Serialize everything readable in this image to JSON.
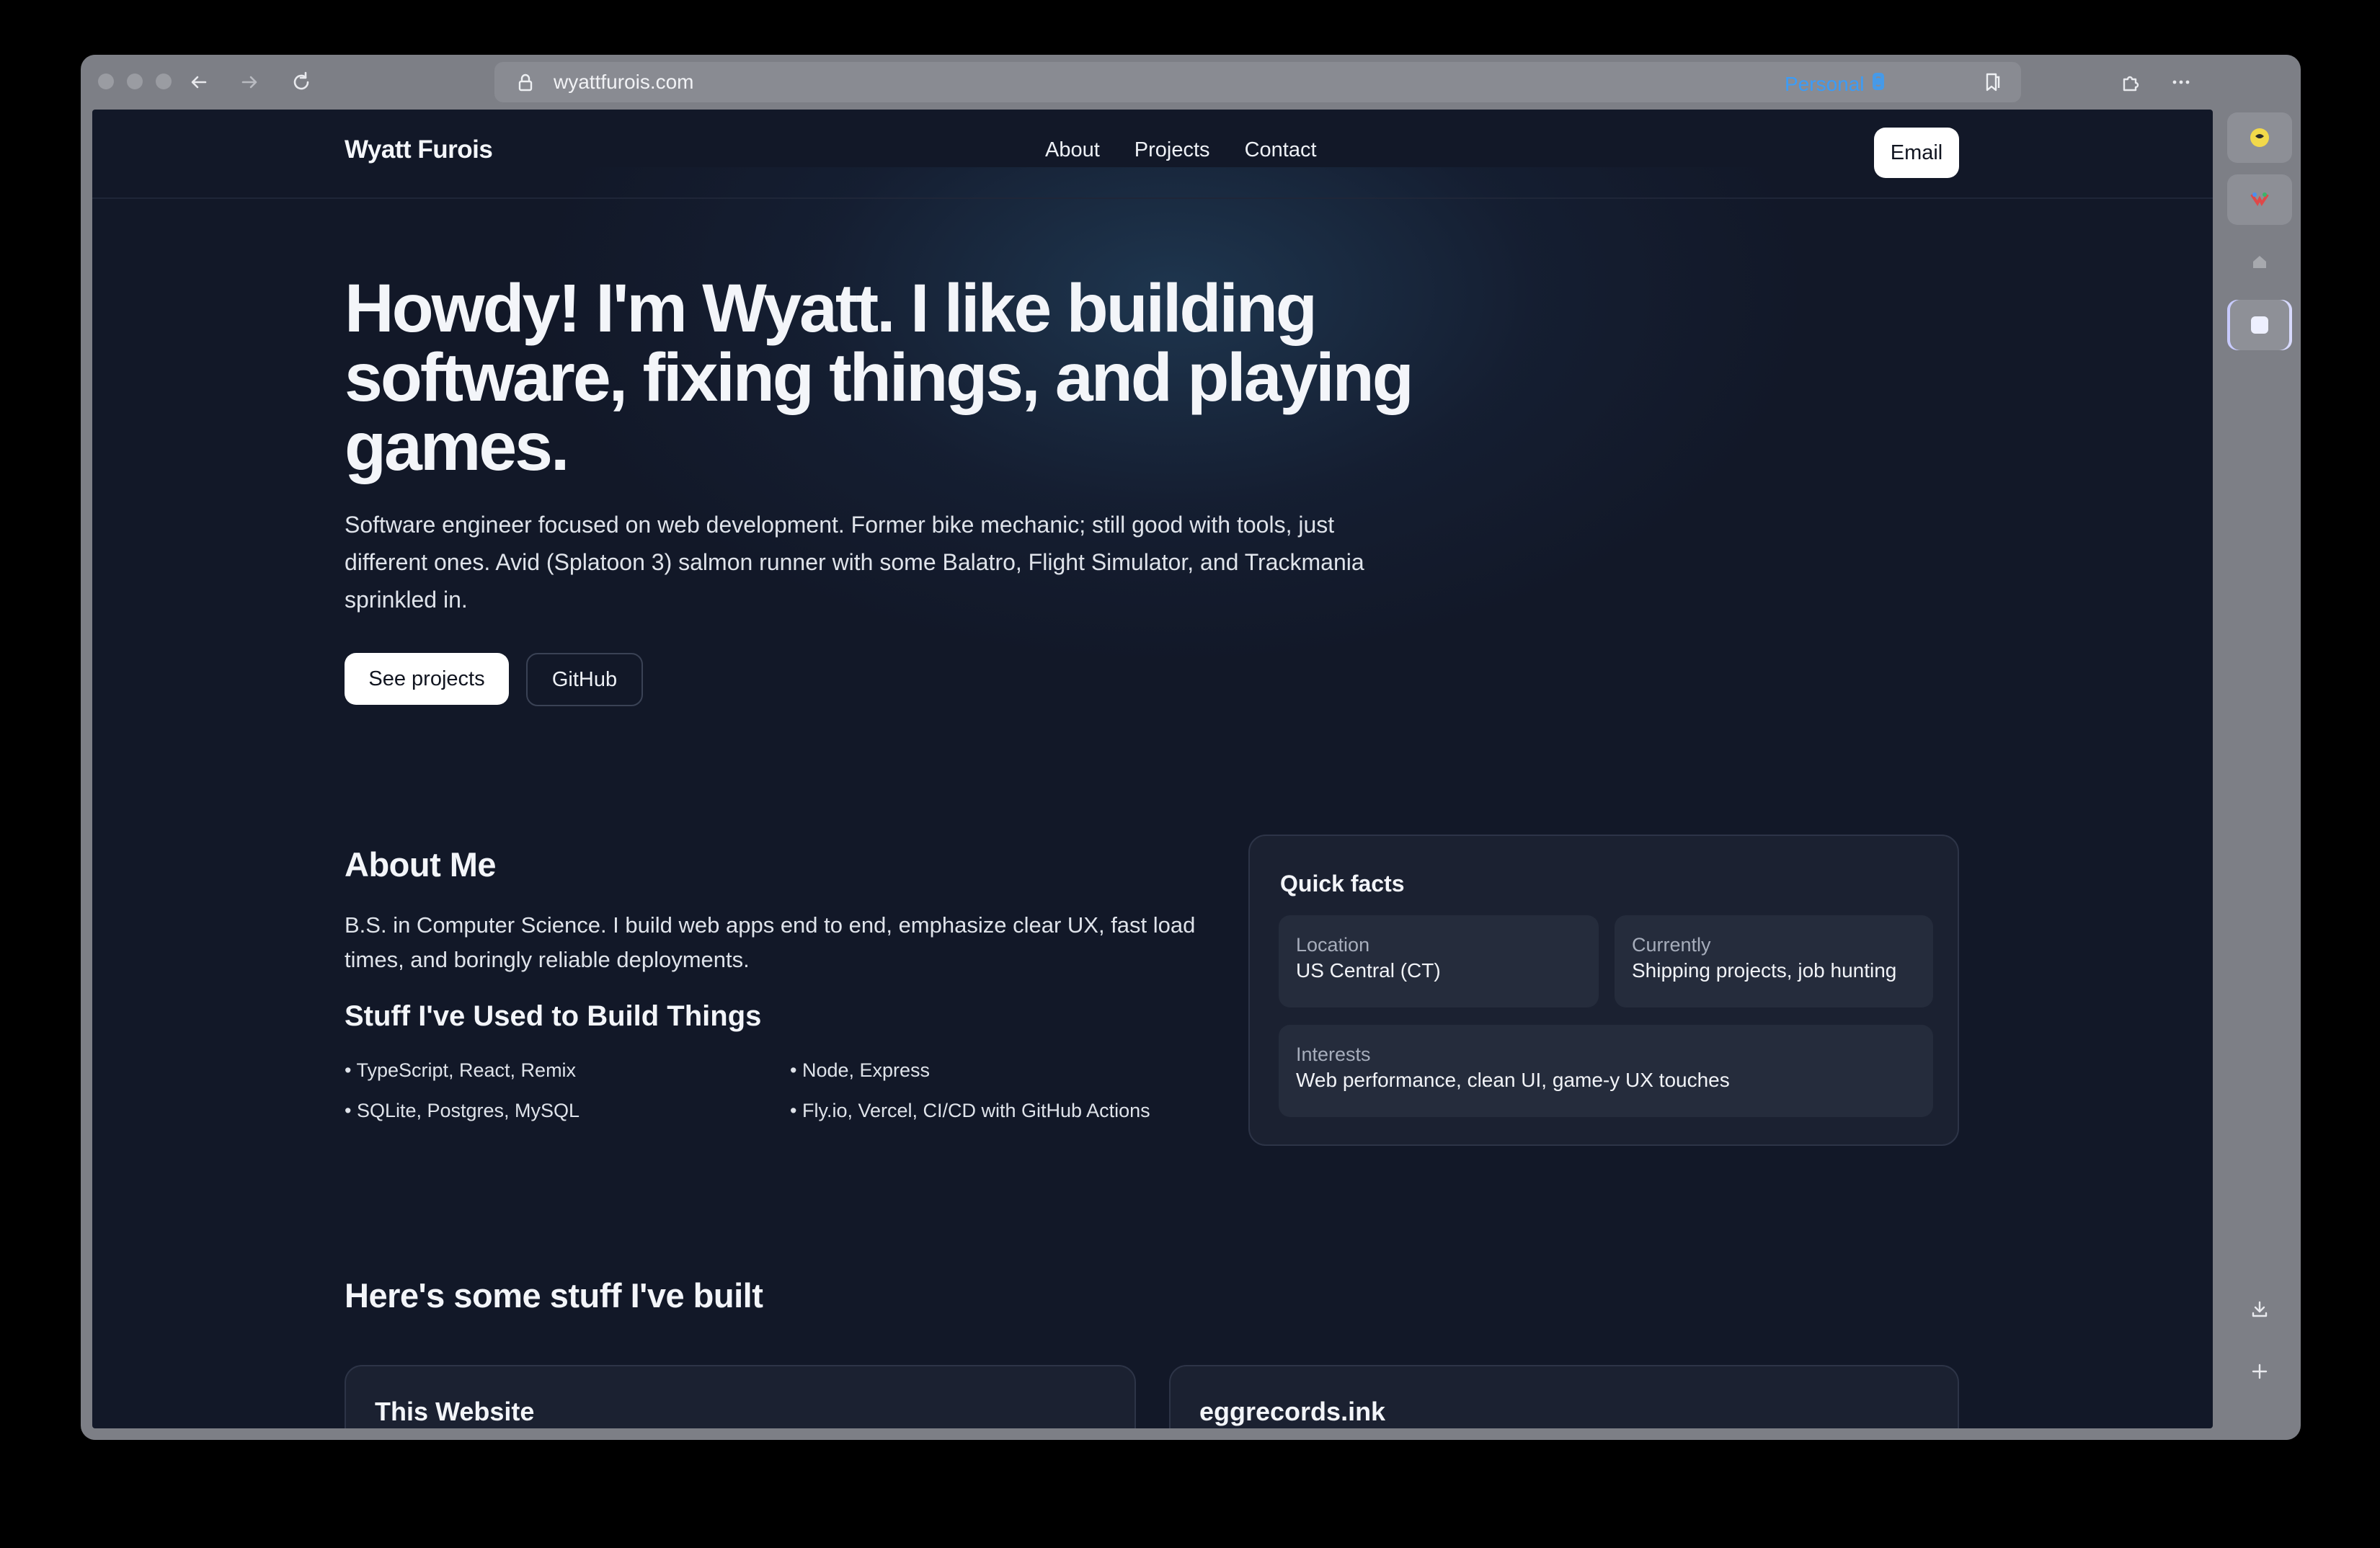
{
  "browser": {
    "url": "wyattfurois.com",
    "profile_label": "Personal"
  },
  "nav": {
    "brand": "Wyatt Furois",
    "links": [
      "About",
      "Projects",
      "Contact"
    ],
    "email_button": "Email"
  },
  "hero": {
    "title": "Howdy! I'm Wyatt. I like building software, fixing things, and playing games.",
    "subtitle": "Software engineer focused on web development. Former bike mechanic; still good with tools, just different ones. Avid (Splatoon 3) salmon runner with some Balatro, Flight Simulator, and Trackmania sprinkled in.",
    "primary_button": "See projects",
    "secondary_button": "GitHub"
  },
  "about": {
    "title": "About Me",
    "text": "B.S. in Computer Science. I build web apps end to end, emphasize clear UX, fast load times, and boringly reliable deployments.",
    "stack_title": "Stuff I've Used to Build Things",
    "stack": [
      "• TypeScript, React, Remix",
      "• Node, Express",
      "• SQLite, Postgres, MySQL",
      "• Fly.io, Vercel, CI/CD with GitHub Actions"
    ]
  },
  "facts": {
    "title": "Quick facts",
    "items": [
      {
        "label": "Location",
        "value": "US Central (CT)"
      },
      {
        "label": "Currently",
        "value": "Shipping projects, job hunting"
      },
      {
        "label": "Interests",
        "value": "Web performance, clean UI, game-y UX touches"
      }
    ]
  },
  "projects": {
    "title": "Here's some stuff I've built",
    "cards": [
      "This Website",
      "eggrecords.ink"
    ]
  },
  "sidebar": {
    "icons": [
      "app-icon-1",
      "app-icon-2",
      "home-icon",
      "active-tab-icon",
      "download-icon",
      "add-icon"
    ]
  }
}
